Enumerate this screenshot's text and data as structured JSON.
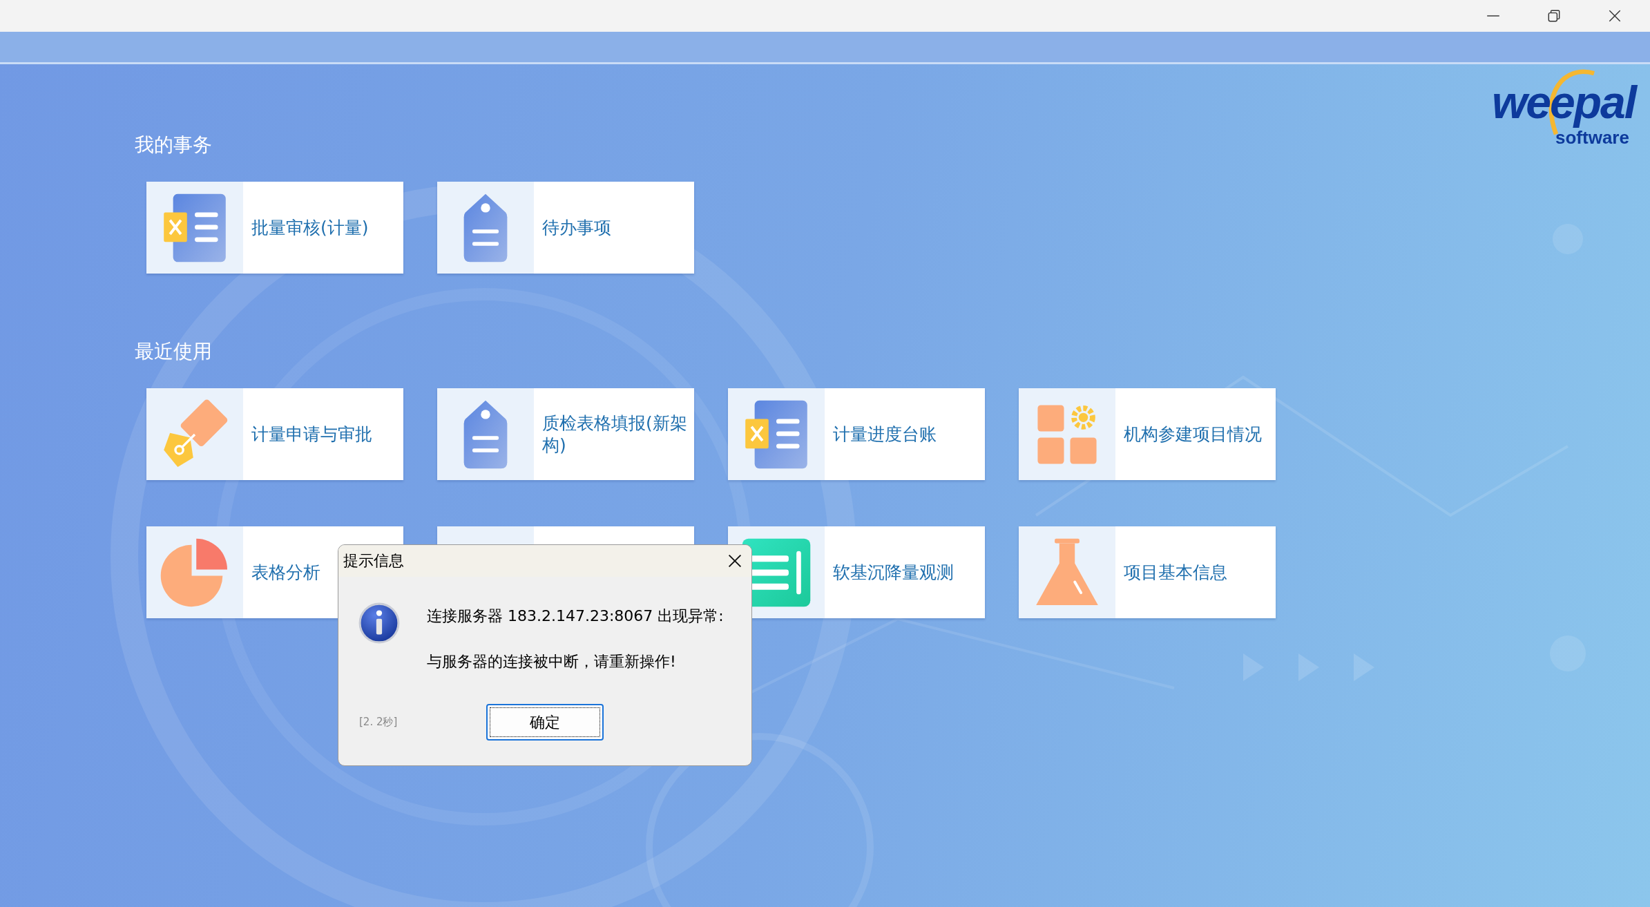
{
  "logo": {
    "name": "weepal",
    "tagline": "software"
  },
  "sections": [
    {
      "title": "我的事务",
      "tiles": [
        {
          "kind": "sheet",
          "label": "批量审核(计量)"
        },
        {
          "kind": "tag",
          "label": "待办事项"
        }
      ]
    },
    {
      "title": "最近使用",
      "tiles": [
        {
          "kind": "pen",
          "label": "计量申请与审批"
        },
        {
          "kind": "tag",
          "label": "质检表格填报(新架构)"
        },
        {
          "kind": "sheet",
          "label": "计量进度台账"
        },
        {
          "kind": "blocks",
          "label": "机构参建项目情况"
        },
        {
          "kind": "pie",
          "label": "表格分析"
        },
        {
          "kind": "covered"
        },
        {
          "kind": "list",
          "label": "软基沉降量观测"
        },
        {
          "kind": "flask",
          "label": "项目基本信息"
        }
      ]
    }
  ],
  "dialog": {
    "title": "提示信息",
    "message": [
      "连接服务器 183.2.147.23:8067 出现异常:",
      "与服务器的连接被中断，请重新操作!"
    ],
    "countdown": "[2. 2秒]",
    "ok_button": "确定"
  }
}
